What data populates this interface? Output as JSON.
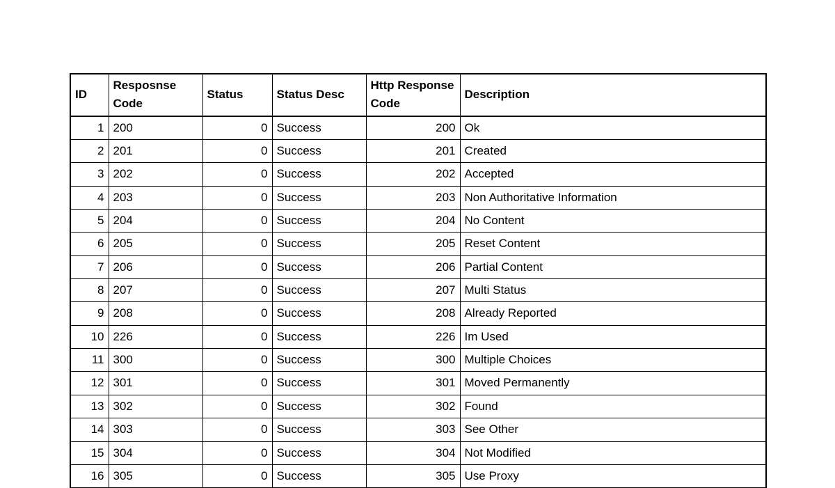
{
  "headers": {
    "id": "ID",
    "response_code": "Resposnse Code",
    "status": "Status",
    "status_desc": "Status Desc",
    "http_response_code": "Http Response Code",
    "description": "Description"
  },
  "rows": [
    {
      "id": "1",
      "response_code": "200",
      "status": "0",
      "status_desc": "Success",
      "http_response_code": "200",
      "description": "Ok"
    },
    {
      "id": "2",
      "response_code": "201",
      "status": "0",
      "status_desc": "Success",
      "http_response_code": "201",
      "description": "Created"
    },
    {
      "id": "3",
      "response_code": "202",
      "status": "0",
      "status_desc": "Success",
      "http_response_code": "202",
      "description": "Accepted"
    },
    {
      "id": "4",
      "response_code": "203",
      "status": "0",
      "status_desc": "Success",
      "http_response_code": "203",
      "description": "Non Authoritative Information"
    },
    {
      "id": "5",
      "response_code": "204",
      "status": "0",
      "status_desc": "Success",
      "http_response_code": "204",
      "description": "No Content"
    },
    {
      "id": "6",
      "response_code": "205",
      "status": "0",
      "status_desc": "Success",
      "http_response_code": "205",
      "description": "Reset Content"
    },
    {
      "id": "7",
      "response_code": "206",
      "status": "0",
      "status_desc": "Success",
      "http_response_code": "206",
      "description": "Partial Content"
    },
    {
      "id": "8",
      "response_code": "207",
      "status": "0",
      "status_desc": "Success",
      "http_response_code": "207",
      "description": "Multi Status"
    },
    {
      "id": "9",
      "response_code": "208",
      "status": "0",
      "status_desc": "Success",
      "http_response_code": "208",
      "description": "Already Reported"
    },
    {
      "id": "10",
      "response_code": "226",
      "status": "0",
      "status_desc": "Success",
      "http_response_code": "226",
      "description": "Im Used"
    },
    {
      "id": "11",
      "response_code": "300",
      "status": "0",
      "status_desc": "Success",
      "http_response_code": "300",
      "description": "Multiple Choices"
    },
    {
      "id": "12",
      "response_code": "301",
      "status": "0",
      "status_desc": "Success",
      "http_response_code": "301",
      "description": "Moved Permanently"
    },
    {
      "id": "13",
      "response_code": "302",
      "status": "0",
      "status_desc": "Success",
      "http_response_code": "302",
      "description": "Found"
    },
    {
      "id": "14",
      "response_code": "303",
      "status": "0",
      "status_desc": "Success",
      "http_response_code": "303",
      "description": "See Other"
    },
    {
      "id": "15",
      "response_code": "304",
      "status": "0",
      "status_desc": "Success",
      "http_response_code": "304",
      "description": "Not Modified"
    },
    {
      "id": "16",
      "response_code": "305",
      "status": "0",
      "status_desc": "Success",
      "http_response_code": "305",
      "description": "Use Proxy"
    }
  ]
}
